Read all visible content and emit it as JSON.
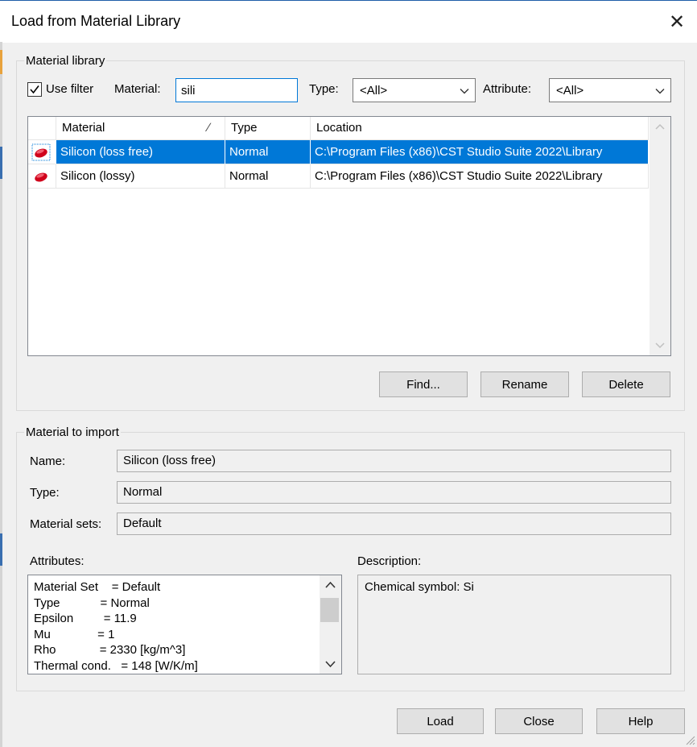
{
  "window": {
    "title": "Load from Material Library"
  },
  "library": {
    "group_label": "Material library",
    "use_filter_label": "Use filter",
    "use_filter_checked": true,
    "material_label": "Material:",
    "material_value": "sili",
    "type_label": "Type:",
    "type_value": "<All>",
    "attribute_label": "Attribute:",
    "attribute_value": "<All>",
    "columns": {
      "material": "Material",
      "type": "Type",
      "location": "Location"
    },
    "rows": [
      {
        "material": "Silicon (loss free)",
        "type": "Normal",
        "location": "C:\\Program Files (x86)\\CST Studio Suite 2022\\Library",
        "selected": true
      },
      {
        "material": "Silicon (lossy)",
        "type": "Normal",
        "location": "C:\\Program Files (x86)\\CST Studio Suite 2022\\Library",
        "selected": false
      }
    ],
    "buttons": {
      "find": "Find...",
      "rename": "Rename",
      "delete": "Delete"
    }
  },
  "import": {
    "group_label": "Material to import",
    "name_label": "Name:",
    "name_value": "Silicon (loss free)",
    "type_label": "Type:",
    "type_value": "Normal",
    "sets_label": "Material sets:",
    "sets_value": "Default",
    "attributes_label": "Attributes:",
    "attributes": [
      "Material Set    = Default",
      "Type            = Normal",
      "Epsilon         = 11.9",
      "Mu              = 1",
      "Rho             = 2330 [kg/m^3]",
      "Thermal cond.   = 148 [W/K/m]"
    ],
    "description_label": "Description:",
    "description_value": "Chemical symbol: Si"
  },
  "footer": {
    "load": "Load",
    "close": "Close",
    "help": "Help"
  },
  "colors": {
    "selection": "#0078d7",
    "focus_border": "#0078d7",
    "icon_red": "#d0021b"
  }
}
